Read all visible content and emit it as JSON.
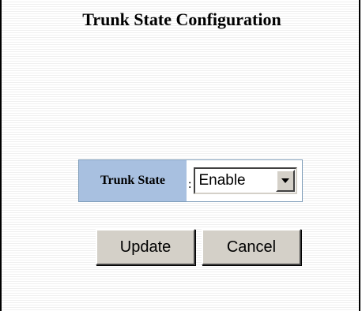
{
  "page": {
    "title": "Trunk State Configuration"
  },
  "form": {
    "trunk_state": {
      "label": "Trunk State",
      "separator": ":",
      "selected_value": "Enable",
      "icon": "chevron-down-icon"
    }
  },
  "buttons": {
    "update_label": "Update",
    "cancel_label": "Cancel"
  },
  "colors": {
    "label_background": "#a8c0e0",
    "button_face": "#d4d0c8"
  }
}
